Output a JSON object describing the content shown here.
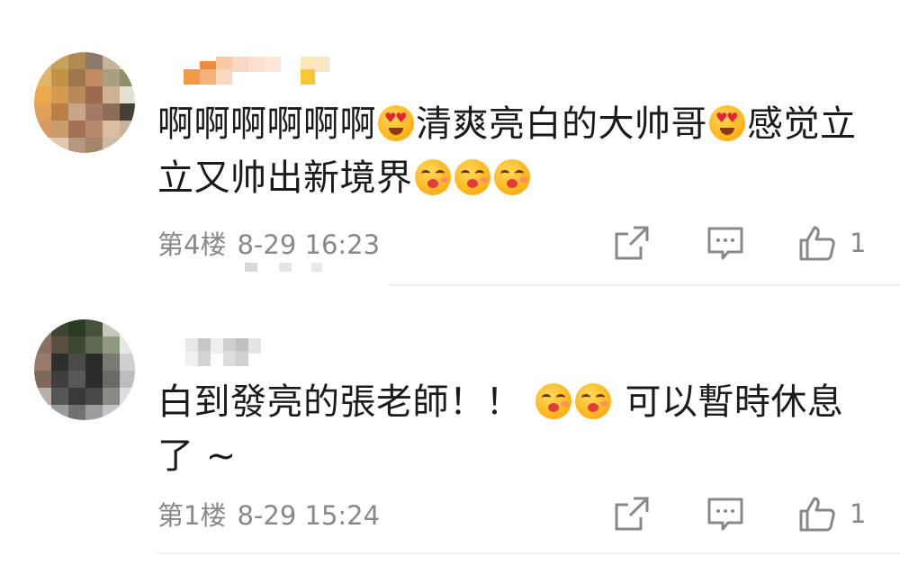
{
  "comments": [
    {
      "text_parts": [
        "啊啊啊啊啊啊",
        "清爽亮白的大帅哥",
        "感觉立立又帅出新境界"
      ],
      "floor": "第4楼",
      "datetime": "8-29 16:23",
      "like_count": "1",
      "emoji_1": "heart-eyes-emoji",
      "emoji_2": "heart-eyes-emoji",
      "emoji_3": "kiss-emoji"
    },
    {
      "text_parts": [
        "白到發亮的張老師！！",
        "可以暫時休息了 ~"
      ],
      "floor": "第1楼",
      "datetime": "8-29 15:24",
      "like_count": "1",
      "emoji_1": "kiss-emoji"
    }
  ],
  "icons": {
    "share": "share-icon",
    "comment": "comment-icon",
    "like": "thumbs-up-icon"
  },
  "colors": {
    "text": "#1b1b1b",
    "meta": "#888888",
    "icon": "#888888"
  }
}
